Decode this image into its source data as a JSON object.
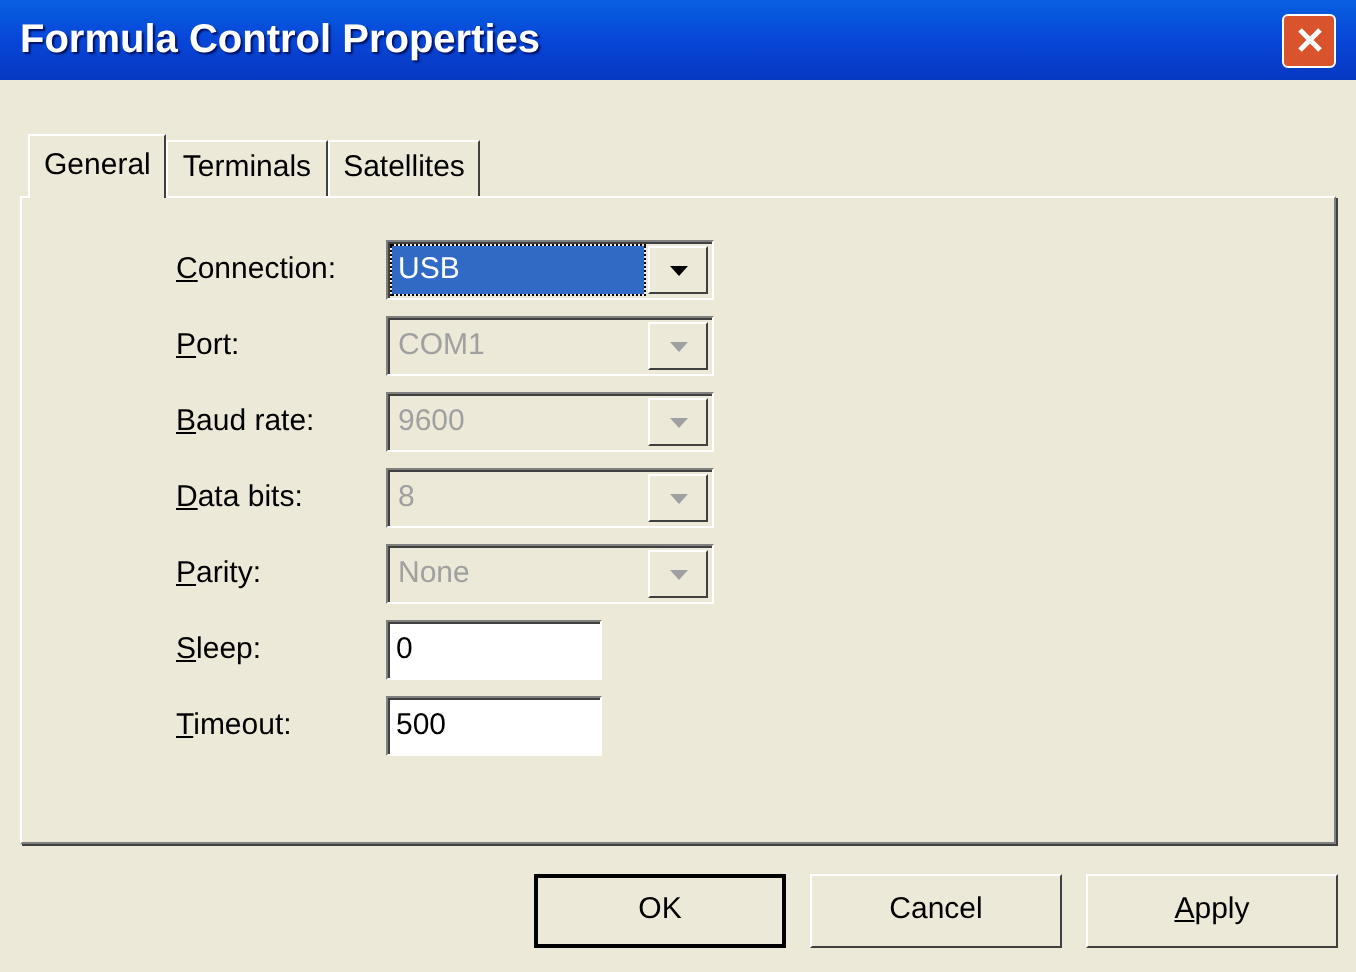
{
  "window": {
    "title": "Formula Control Properties"
  },
  "tabs": [
    {
      "label": "General",
      "selected": true
    },
    {
      "label": "Terminals",
      "selected": false
    },
    {
      "label": "Satellites",
      "selected": false
    }
  ],
  "fields": [
    {
      "kind": "combo",
      "label": "Connection:",
      "value": "USB",
      "disabled": false,
      "focused": true
    },
    {
      "kind": "combo",
      "label": "Port:",
      "value": "COM1",
      "disabled": true,
      "focused": false
    },
    {
      "kind": "combo",
      "label": "Baud rate:",
      "value": "9600",
      "disabled": true,
      "focused": false
    },
    {
      "kind": "combo",
      "label": "Data bits:",
      "value": "8",
      "disabled": true,
      "focused": false
    },
    {
      "kind": "combo",
      "label": "Parity:",
      "value": "None",
      "disabled": true,
      "focused": false
    },
    {
      "kind": "text",
      "label": "Sleep:",
      "value": "0"
    },
    {
      "kind": "text",
      "label": "Timeout:",
      "value": "500"
    }
  ],
  "buttons": [
    {
      "label": "OK",
      "default": true,
      "underline_first": false
    },
    {
      "label": "Cancel",
      "default": false,
      "underline_first": false
    },
    {
      "label": "Apply",
      "default": false,
      "underline_first": true
    }
  ]
}
